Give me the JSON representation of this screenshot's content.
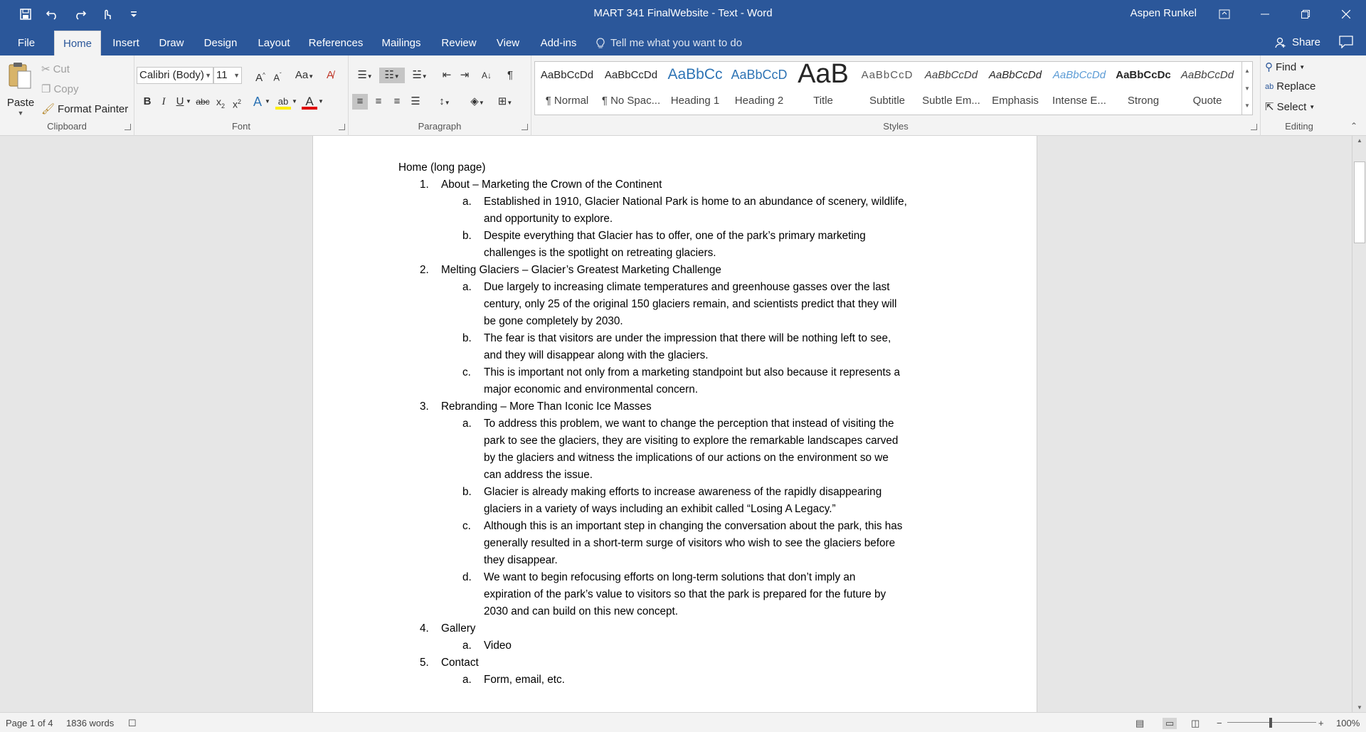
{
  "window": {
    "title": "MART 341 FinalWebsite - Text  -  Word",
    "user": "Aspen Runkel"
  },
  "tabs": [
    "File",
    "Home",
    "Insert",
    "Draw",
    "Design",
    "Layout",
    "References",
    "Mailings",
    "Review",
    "View",
    "Add-ins"
  ],
  "tell_me": "Tell me what you want to do",
  "share": "Share",
  "clipboard": {
    "paste": "Paste",
    "cut": "Cut",
    "copy": "Copy",
    "format_painter": "Format Painter",
    "label": "Clipboard"
  },
  "font": {
    "name": "Calibri (Body)",
    "size": "11",
    "label": "Font",
    "case_btn": "Aa"
  },
  "paragraph": {
    "label": "Paragraph"
  },
  "styles": {
    "label": "Styles",
    "items": [
      {
        "sample": "AaBbCcDd",
        "name": "¶ Normal"
      },
      {
        "sample": "AaBbCcDd",
        "name": "¶ No Spac..."
      },
      {
        "sample": "AaBbCc",
        "name": "Heading 1"
      },
      {
        "sample": "AaBbCcD",
        "name": "Heading 2"
      },
      {
        "sample": "AaB",
        "name": "Title"
      },
      {
        "sample": "AaBbCcD",
        "name": "Subtitle"
      },
      {
        "sample": "AaBbCcDd",
        "name": "Subtle Em..."
      },
      {
        "sample": "AaBbCcDd",
        "name": "Emphasis"
      },
      {
        "sample": "AaBbCcDd",
        "name": "Intense E..."
      },
      {
        "sample": "AaBbCcDc",
        "name": "Strong"
      },
      {
        "sample": "AaBbCcDd",
        "name": "Quote"
      }
    ]
  },
  "editing": {
    "find": "Find",
    "replace": "Replace",
    "select": "Select",
    "label": "Editing"
  },
  "document": {
    "heading": "Home (long page)",
    "lines": [
      {
        "level": 1,
        "num": "1.",
        "text": "About – Marketing the Crown of the Continent"
      },
      {
        "level": 2,
        "num": "a.",
        "text": "Established in 1910, Glacier National Park is home to an abundance of scenery, wildlife,"
      },
      {
        "level": 2,
        "num": "",
        "text": "and opportunity to explore."
      },
      {
        "level": 2,
        "num": "b.",
        "text": "Despite everything that Glacier has to offer, one of the park’s primary marketing"
      },
      {
        "level": 2,
        "num": "",
        "text": "challenges is the spotlight on retreating glaciers."
      },
      {
        "level": 1,
        "num": "2.",
        "text": "Melting Glaciers – Glacier’s Greatest Marketing Challenge"
      },
      {
        "level": 2,
        "num": "a.",
        "text": "Due largely to increasing climate temperatures and greenhouse gasses over the last"
      },
      {
        "level": 2,
        "num": "",
        "text": "century, only 25 of the original 150 glaciers remain, and scientists predict that they will"
      },
      {
        "level": 2,
        "num": "",
        "text": "be gone completely by 2030."
      },
      {
        "level": 2,
        "num": "b.",
        "text": "The fear is that visitors are under the impression that there will be nothing left to see,"
      },
      {
        "level": 2,
        "num": "",
        "text": "and they will disappear along with the glaciers."
      },
      {
        "level": 2,
        "num": "c.",
        "text": "This is important not only from a marketing standpoint but also because it represents a"
      },
      {
        "level": 2,
        "num": "",
        "text": "major economic and environmental concern."
      },
      {
        "level": 1,
        "num": "3.",
        "text": "Rebranding – More Than Iconic Ice Masses"
      },
      {
        "level": 2,
        "num": "a.",
        "text": "To address this problem, we want to change the perception that instead of visiting the"
      },
      {
        "level": 2,
        "num": "",
        "text": "park to see the glaciers, they are visiting to explore the remarkable landscapes carved"
      },
      {
        "level": 2,
        "num": "",
        "text": "by the glaciers and witness the implications of our actions on the environment so we"
      },
      {
        "level": 2,
        "num": "",
        "text": "can address the issue."
      },
      {
        "level": 2,
        "num": "b.",
        "text": "Glacier is already making efforts to increase awareness of the rapidly disappearing"
      },
      {
        "level": 2,
        "num": "",
        "text": "glaciers in a variety of ways including an exhibit called “Losing A Legacy.”"
      },
      {
        "level": 2,
        "num": "c.",
        "text": "Although this is an important step in changing the conversation about the park, this has"
      },
      {
        "level": 2,
        "num": "",
        "text": "generally resulted in a short-term surge of visitors who wish to see the glaciers before"
      },
      {
        "level": 2,
        "num": "",
        "text": "they disappear."
      },
      {
        "level": 2,
        "num": "d.",
        "text": "We want to begin refocusing efforts on long-term solutions that don’t imply an"
      },
      {
        "level": 2,
        "num": "",
        "text": "expiration of the park’s value to visitors so that the park is prepared for the future by"
      },
      {
        "level": 2,
        "num": "",
        "text": "2030 and can build on this new concept."
      },
      {
        "level": 1,
        "num": "4.",
        "text": "Gallery"
      },
      {
        "level": 2,
        "num": "a.",
        "text": "Video"
      },
      {
        "level": 1,
        "num": "5.",
        "text": "Contact"
      },
      {
        "level": 2,
        "num": "a.",
        "text": "Form, email, etc."
      }
    ]
  },
  "status": {
    "page": "Page 1 of 4",
    "words": "1836 words",
    "zoom": "100%"
  },
  "colors": {
    "brand": "#2b579a",
    "heading": "#2e74b5"
  }
}
